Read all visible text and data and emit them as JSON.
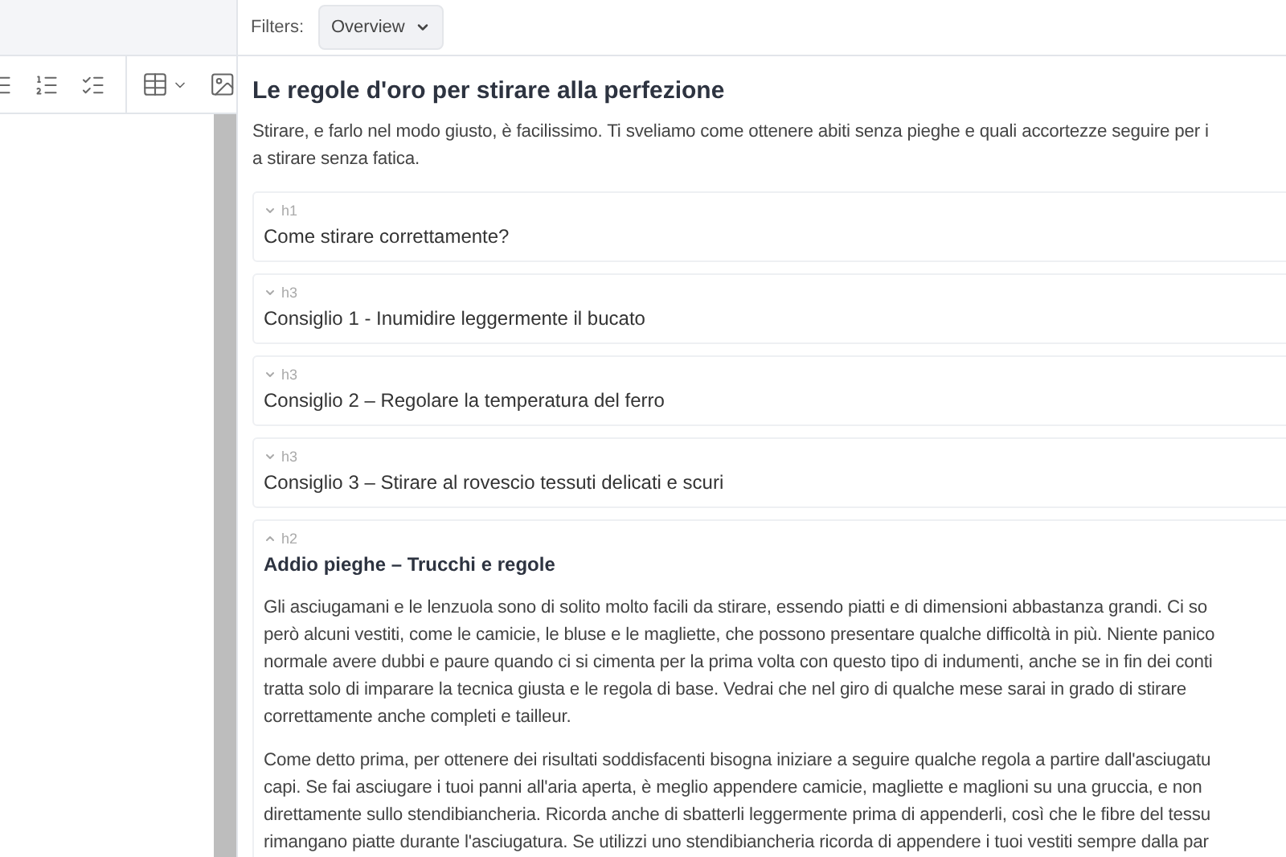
{
  "filters": {
    "label": "Filters:",
    "value": "Overview"
  },
  "article": {
    "title": "Le regole d'oro per stirare alla perfezione",
    "intro_lines": [
      "Stirare, e farlo nel modo giusto, è facilissimo. Ti sveliamo come ottenere abiti senza pieghe e quali accortezze seguire per i",
      "a stirare senza fatica."
    ],
    "sections": [
      {
        "tag": "h1",
        "heading": "Come stirare correttamente?",
        "expanded": false
      },
      {
        "tag": "h3",
        "heading": "Consiglio 1 - Inumidire leggermente il bucato",
        "expanded": false
      },
      {
        "tag": "h3",
        "heading": "Consiglio 2 – Regolare la temperatura del ferro",
        "expanded": false
      },
      {
        "tag": "h3",
        "heading": "Consiglio 3 – Stirare al rovescio tessuti delicati e scuri",
        "expanded": false
      },
      {
        "tag": "h2",
        "heading": "Addio pieghe – Trucchi e regole",
        "expanded": true,
        "paragraphs": [
          [
            "Gli asciugamani e le lenzuola sono di solito molto facili da stirare, essendo piatti e di dimensioni abbastanza grandi. Ci so",
            "però alcuni vestiti, come le camicie, le bluse e le magliette, che possono presentare qualche difficoltà in più. Niente panico",
            "normale avere dubbi e paure quando ci si cimenta per la prima volta con questo tipo di indumenti, anche se in fin dei conti",
            "tratta solo di imparare la tecnica giusta e le regola di base. Vedrai che nel giro di qualche mese sarai in grado di stirare",
            "correttamente anche completi e tailleur."
          ],
          [
            "Come detto prima, per ottenere dei risultati soddisfacenti bisogna iniziare a seguire qualche regola a partire dall'asciugatu",
            "capi. Se fai asciugare i tuoi panni all'aria aperta, è meglio appendere camicie, magliette e maglioni su una gruccia, e non",
            "direttamente sullo stendibiancheria. Ricorda anche di sbatterli leggermente prima di appenderli, così che le fibre del tessu",
            "rimangano piatte durante l'asciugatura. Se utilizzi uno stendibiancheria ricorda di appendere i tuoi vestiti sempre dalla par"
          ]
        ]
      }
    ]
  }
}
